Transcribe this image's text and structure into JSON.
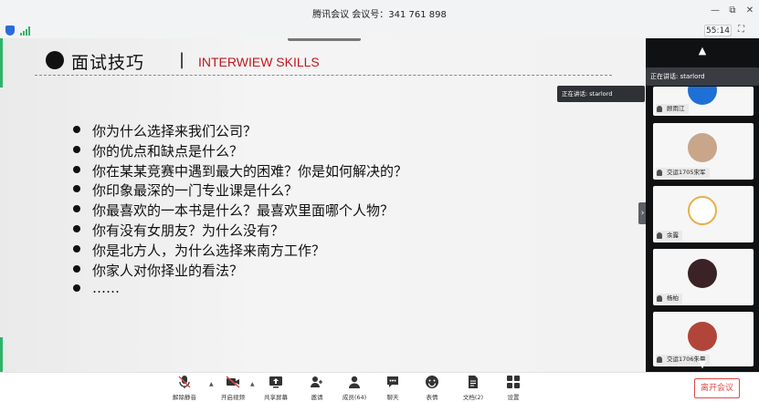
{
  "window": {
    "title": "腾讯会议 会议号：341 761 898",
    "minimize": "—",
    "restore": "⧉",
    "close": "✕"
  },
  "status": {
    "timer": "55:14",
    "fullscreen_glyph": "⛶"
  },
  "slide": {
    "heading_cn": "面试技巧",
    "separator": "|",
    "heading_en": "INTERWIEW SKILLS",
    "questions": [
      "你为什么选择来我们公司？",
      "你的优点和缺点是什么？",
      "你在某某竞赛中遇到最大的困难？你是如何解决的？",
      "你印象最深的一门专业课是什么？",
      "你最喜欢的一本书是什么？最喜欢里面哪个人物？",
      "你有没有女朋友？为什么没有？",
      "你是北方人，为什么选择来南方工作？",
      "你家人对你择业的看法？",
      "……"
    ],
    "speaker_tip": "正在讲话: starlord",
    "handle_glyph": "›"
  },
  "panel": {
    "speaker_tip": "正在讲话: starlord",
    "up_arrow": "▲",
    "down_arrow": "▼",
    "participants": [
      {
        "name": "顾雨江",
        "avatar_color": "#1e6fd6"
      },
      {
        "name": "交运1705宋军",
        "avatar_color": "#c9a58a"
      },
      {
        "name": "余露",
        "avatar_color": "#e8b04a"
      },
      {
        "name": "杨柏",
        "avatar_color": "#3a2226"
      },
      {
        "name": "交运1706朱晨",
        "avatar_color": "#b1453a"
      }
    ]
  },
  "toolbar": {
    "unmute": "解除静音",
    "start_video": "开启视频",
    "share_screen": "共享屏幕",
    "invite": "邀请",
    "members": "成员(64)",
    "chat": "聊天",
    "reactions": "表情",
    "documents": "文档(2)",
    "settings": "设置",
    "leave": "离开会议",
    "caret": "▲"
  },
  "colors": {
    "accent_green": "#2db36a",
    "heading_red": "#c2151b",
    "leave_red": "#e0494a"
  }
}
